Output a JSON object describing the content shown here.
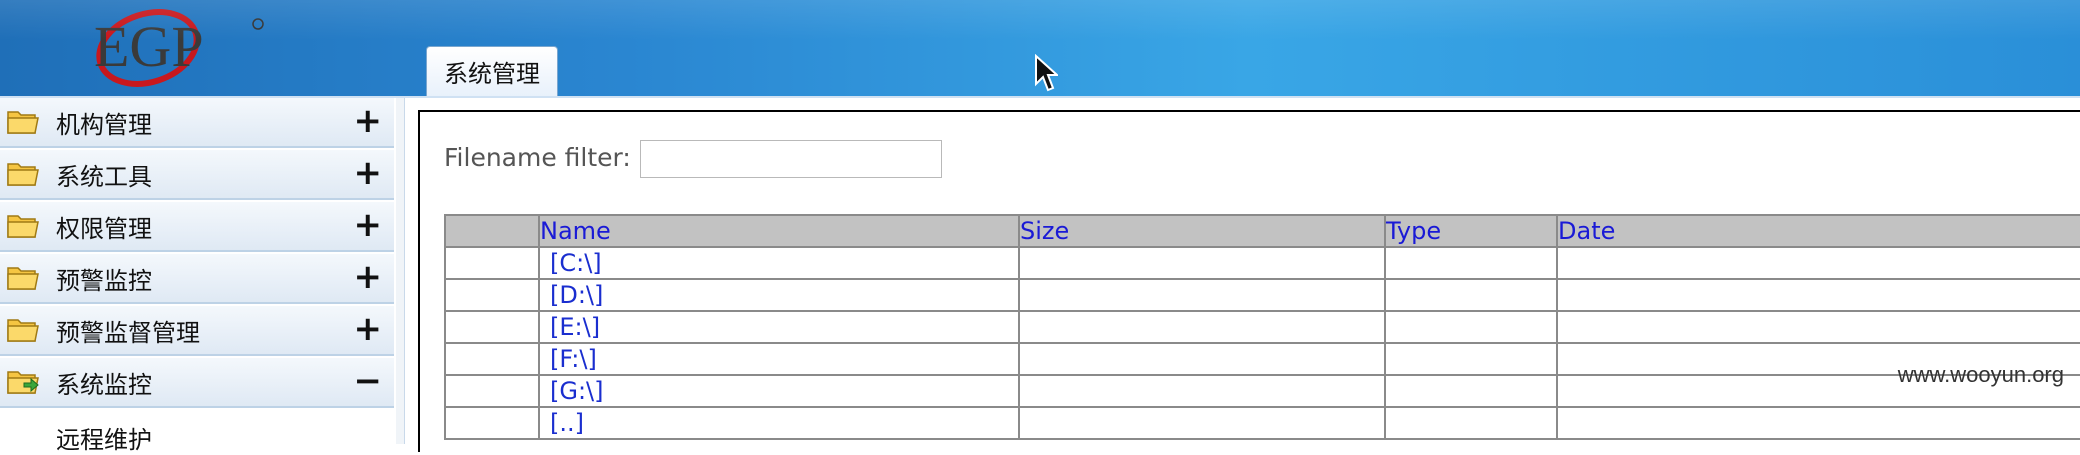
{
  "header": {
    "logo_text": "EGP",
    "active_tab": "系统管理"
  },
  "sidebar": {
    "items": [
      {
        "label": "机构管理",
        "toggle": "+",
        "icon": "folder-icon"
      },
      {
        "label": "系统工具",
        "toggle": "+",
        "icon": "folder-icon"
      },
      {
        "label": "权限管理",
        "toggle": "+",
        "icon": "folder-icon"
      },
      {
        "label": "预警监控",
        "toggle": "+",
        "icon": "folder-icon"
      },
      {
        "label": "预警监督管理",
        "toggle": "+",
        "icon": "folder-icon"
      },
      {
        "label": "系统监控",
        "toggle": "−",
        "icon": "folder-open-icon"
      }
    ],
    "sub_items": [
      {
        "label": "远程维护"
      }
    ]
  },
  "main": {
    "filter": {
      "label": "Filename filter:",
      "value": "",
      "placeholder": ""
    },
    "table": {
      "columns": [
        "",
        "Name",
        "Size",
        "Type",
        "Date"
      ],
      "rows": [
        {
          "name": "[C:\\]",
          "size": "",
          "type": "",
          "date": ""
        },
        {
          "name": "[D:\\]",
          "size": "",
          "type": "",
          "date": ""
        },
        {
          "name": "[E:\\]",
          "size": "",
          "type": "",
          "date": ""
        },
        {
          "name": "[F:\\]",
          "size": "",
          "type": "",
          "date": ""
        },
        {
          "name": "[G:\\]",
          "size": "",
          "type": "",
          "date": ""
        },
        {
          "name": "[..]",
          "size": "",
          "type": "",
          "date": ""
        }
      ]
    }
  },
  "watermark": "www.wooyun.org",
  "colors": {
    "header_blue": "#2a86d1",
    "link_blue": "#1a2ecf",
    "table_header_gray": "#c2c2c2"
  }
}
